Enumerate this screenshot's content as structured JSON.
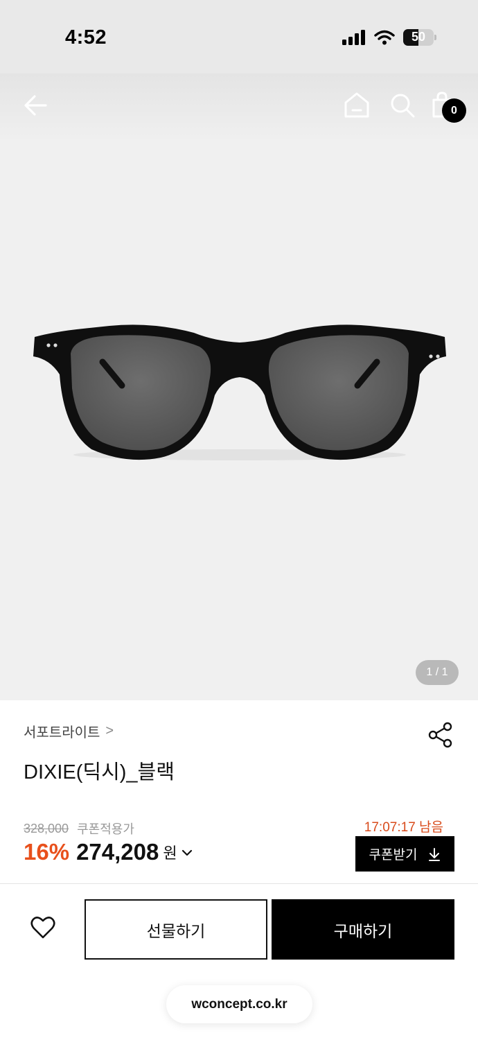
{
  "status_bar": {
    "time": "4:52",
    "battery": "50",
    "battery_level": 0.5
  },
  "nav": {
    "back_icon": "arrow-left-icon",
    "home_icon": "home-icon",
    "search_icon": "search-icon",
    "cart_icon": "shopping-bag-icon",
    "cart_count": "0"
  },
  "gallery": {
    "page_indicator": "1 / 1"
  },
  "product": {
    "brand": "서포트라이트",
    "brand_chevron": ">",
    "title": "DIXIE(딕시)_블랙",
    "original_price": "328,000",
    "coupon_label": "쿠폰적용가",
    "discount": "16%",
    "sale_price": "274,208",
    "currency": "원",
    "price_chevron": "⌄",
    "share_icon": "share-icon"
  },
  "coupon": {
    "timer": "17:07:17 남음",
    "button_label": "쿠폰받기",
    "button_icon": "download-icon"
  },
  "actions": {
    "wish_icon": "heart-icon",
    "gift_label": "선물하기",
    "buy_label": "구매하기"
  },
  "browser": {
    "url": "wconcept.co.kr"
  },
  "colors": {
    "accent": "#e8501c",
    "timer": "#d84a1a",
    "primary_button": "#000000"
  }
}
